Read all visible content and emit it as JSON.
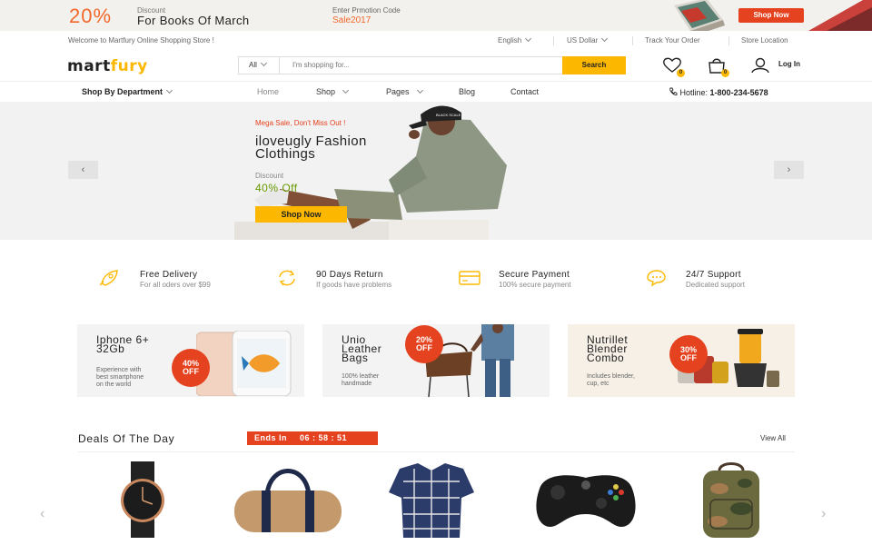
{
  "promo_bar": {
    "percent": "20%",
    "label_small": "Discount",
    "label_big": "For Books Of March",
    "code_label": "Enter Prmotion Code",
    "code": "Sale2017",
    "button": "Shop Now"
  },
  "utility": {
    "welcome": "Welcome to Martfury Online Shopping Store !",
    "language": "English",
    "currency": "US Dollar",
    "track": "Track Your Order",
    "store": "Store Location"
  },
  "header": {
    "logo_part1": "mart",
    "logo_part2": "fury",
    "search_category": "All",
    "search_placeholder": "I'm shopping for...",
    "search_button": "Search",
    "wishlist_count": "0",
    "cart_count": "0",
    "login": "Log In"
  },
  "nav": {
    "department": "Shop By Department",
    "items": [
      "Home",
      "Shop",
      "Pages",
      "Blog",
      "Contact"
    ],
    "hotline_label": "Hotline:",
    "hotline_number": "1-800-234-5678"
  },
  "hero": {
    "kicker": "Mega Sale, Don't Miss Out !",
    "title_line1": "iloveugly Fashion",
    "title_line2": "Clothings",
    "discount_label": "Discount",
    "discount_value": "40% Off",
    "button": "Shop Now",
    "cap_text": "BLACK SCALE"
  },
  "features": [
    {
      "title": "Free Delivery",
      "sub": "For all oders over $99",
      "icon": "rocket-icon"
    },
    {
      "title": "90 Days Return",
      "sub": "If goods have problems",
      "icon": "return-icon"
    },
    {
      "title": "Secure Payment",
      "sub": "100% secure payment",
      "icon": "credit-card-icon"
    },
    {
      "title": "24/7 Support",
      "sub": "Dedicated support",
      "icon": "support-chat-icon"
    }
  ],
  "cards": [
    {
      "title1": "Iphone 6+",
      "title2": "32Gb",
      "sub1": "Experience with",
      "sub2": "best smartphone",
      "sub3": "on the world",
      "badge1": "40%",
      "badge2": "OFF"
    },
    {
      "title1": "Unio",
      "title2": "Leather",
      "title3": "Bags",
      "sub1": "100% leather",
      "sub2": "handmade",
      "badge1": "20%",
      "badge2": "OFF"
    },
    {
      "title1": "Nutrillet",
      "title2": "Blender",
      "title3": "Combo",
      "sub1": "Includes blender,",
      "sub2": "cup, etc",
      "badge1": "30%",
      "badge2": "OFF"
    }
  ],
  "deals": {
    "title": "Deals Of The Day",
    "timer_label": "Ends In",
    "timer_value": "06 : 58 : 51",
    "view_all": "View All",
    "products": [
      "watch",
      "duffel-bag",
      "plaid-shirt",
      "game-controller",
      "camo-backpack"
    ]
  },
  "colors": {
    "accent_yellow": "#fcb800",
    "accent_red": "#e5421f",
    "accent_green": "#669900"
  }
}
